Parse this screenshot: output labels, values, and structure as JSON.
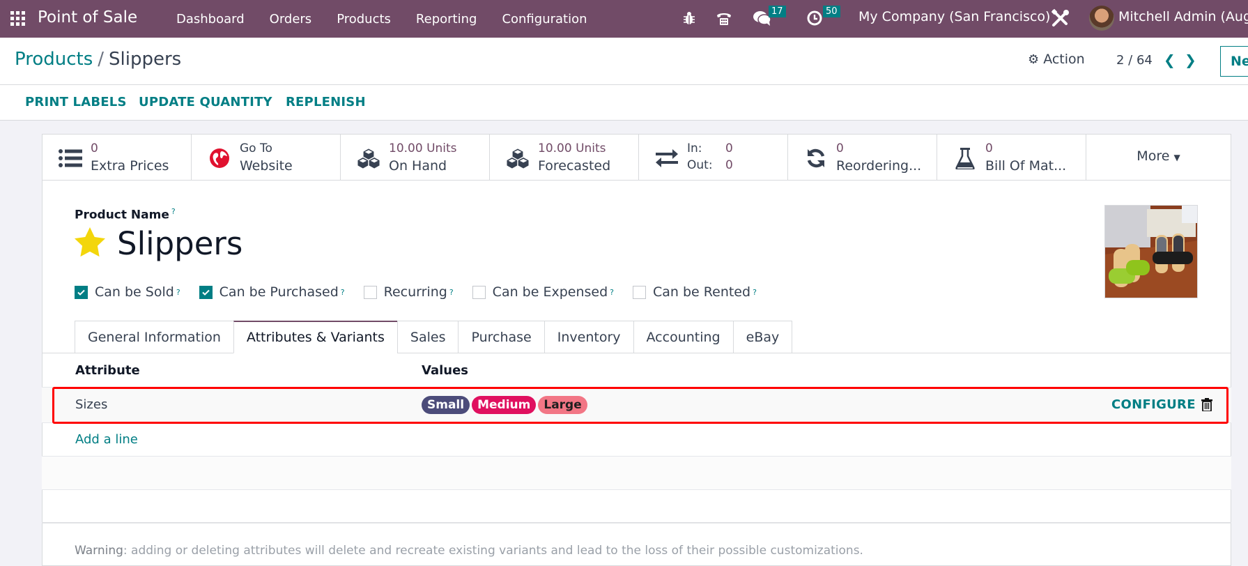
{
  "navbar": {
    "app_name": "Point of Sale",
    "menu": [
      "Dashboard",
      "Orders",
      "Products",
      "Reporting",
      "Configuration"
    ],
    "messages_count": "17",
    "activities_count": "50",
    "company": "My Company (San Francisco)",
    "user": "Mitchell Admin (Aug_",
    "colors": {
      "bar": "#714b67",
      "badge": "#017e84"
    }
  },
  "control_panel": {
    "breadcrumb": {
      "parent": "Products",
      "separator": "/",
      "current": "Slippers"
    },
    "action_label": "Action",
    "pager": "2 / 64",
    "new_label": "Ne"
  },
  "button_bar": {
    "buttons": [
      "PRINT LABELS",
      "UPDATE QUANTITY",
      "REPLENISH"
    ]
  },
  "stat_buttons": [
    {
      "icon": "list-icon",
      "value": "0",
      "label": "Extra Prices"
    },
    {
      "icon": "globe-icon",
      "value": "Go To",
      "label": "Website"
    },
    {
      "icon": "cubes-icon",
      "value": "10.00 Units",
      "label": "On Hand"
    },
    {
      "icon": "cubes-icon",
      "value": "10.00 Units",
      "label": "Forecasted"
    },
    {
      "icon": "exchange-icon",
      "in_label": "In:",
      "in_value": "0",
      "out_label": "Out:",
      "out_value": "0"
    },
    {
      "icon": "refresh-icon",
      "value": "0",
      "label": "Reordering..."
    },
    {
      "icon": "flask-icon",
      "value": "0",
      "label": "Bill Of Mat..."
    },
    {
      "label": "More"
    }
  ],
  "product": {
    "name_label": "Product Name",
    "help": "?",
    "name": "Slippers",
    "favorite": true,
    "flags": [
      {
        "label": "Can be Sold",
        "checked": true
      },
      {
        "label": "Can be Purchased",
        "checked": true
      },
      {
        "label": "Recurring",
        "checked": false
      },
      {
        "label": "Can be Expensed",
        "checked": false
      },
      {
        "label": "Can be Rented",
        "checked": false
      }
    ]
  },
  "tabs": [
    "General Information",
    "Attributes & Variants",
    "Sales",
    "Purchase",
    "Inventory",
    "Accounting",
    "eBay"
  ],
  "active_tab": "Attributes & Variants",
  "attributes_table": {
    "columns": [
      "Attribute",
      "Values"
    ],
    "rows": [
      {
        "attribute": "Sizes",
        "values": [
          {
            "label": "Small",
            "bg": "#4c4c7a",
            "fg": "#ffffff"
          },
          {
            "label": "Medium",
            "bg": "#e0105f",
            "fg": "#ffffff"
          },
          {
            "label": "Large",
            "bg": "#f27685",
            "fg": "#1f1f1f"
          }
        ],
        "configure_label": "CONFIGURE"
      }
    ],
    "add_line": "Add a line"
  },
  "warning": {
    "prefix": "Warning",
    "text": ": adding or deleting attributes will delete and recreate existing variants and lead to the loss of their possible customizations."
  }
}
